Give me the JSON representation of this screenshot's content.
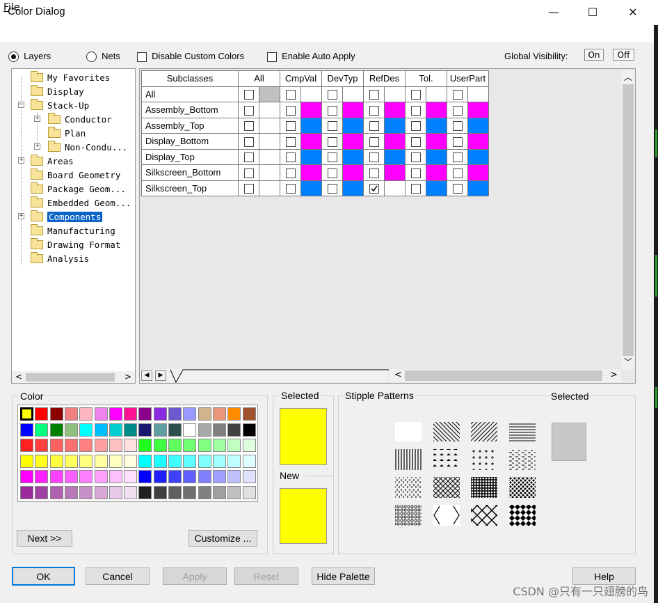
{
  "window": {
    "title": "Color Dialog",
    "minimize": "—",
    "maximize": "☐",
    "close": "✕"
  },
  "menu": {
    "file_u": "F",
    "file_rest": "ile"
  },
  "toolbar": {
    "layers_label": "Layers",
    "nets_label": "Nets",
    "disable_custom_colors": "Disable Custom Colors",
    "enable_auto_apply": "Enable Auto Apply",
    "global_visibility": "Global Visibility:",
    "on": "On",
    "off": "Off"
  },
  "tree": {
    "items": [
      {
        "label": "My Favorites"
      },
      {
        "label": "Display"
      },
      {
        "label": "Stack-Up"
      },
      {
        "label": "Conductor"
      },
      {
        "label": "Plan"
      },
      {
        "label": "Non-Condu..."
      },
      {
        "label": "Areas"
      },
      {
        "label": "Board Geometry"
      },
      {
        "label": "Package Geom..."
      },
      {
        "label": "Embedded Geom..."
      },
      {
        "label": "Components"
      },
      {
        "label": "Manufacturing"
      },
      {
        "label": "Drawing Format"
      },
      {
        "label": "Analysis"
      }
    ]
  },
  "grid": {
    "headers": [
      "Subclasses",
      "All",
      "CmpVal",
      "DevTyp",
      "RefDes",
      "Tol.",
      "UserPart"
    ],
    "rows": [
      {
        "name": "All",
        "colors": [
          "#c0c0c0",
          "#ffffff",
          "#ffffff",
          "#ffffff",
          "#ffffff",
          "#ffffff"
        ],
        "checked": [
          false,
          false,
          false,
          false,
          false,
          false
        ]
      },
      {
        "name": "Assembly_Bottom",
        "colors": [
          "#ffffff",
          "#ff00ff",
          "#ff00ff",
          "#ff00ff",
          "#ff00ff",
          "#ff00ff"
        ],
        "checked": [
          false,
          false,
          false,
          false,
          false,
          false
        ]
      },
      {
        "name": "Assembly_Top",
        "colors": [
          "#ffffff",
          "#0080ff",
          "#0080ff",
          "#0080ff",
          "#0080ff",
          "#0080ff"
        ],
        "checked": [
          false,
          false,
          false,
          false,
          false,
          false
        ]
      },
      {
        "name": "Display_Bottom",
        "colors": [
          "#ffffff",
          "#ff00ff",
          "#ff00ff",
          "#ff00ff",
          "#ff00ff",
          "#ff00ff"
        ],
        "checked": [
          false,
          false,
          false,
          false,
          false,
          false
        ]
      },
      {
        "name": "Display_Top",
        "colors": [
          "#ffffff",
          "#0080ff",
          "#0080ff",
          "#0080ff",
          "#0080ff",
          "#0080ff"
        ],
        "checked": [
          false,
          false,
          false,
          false,
          false,
          false
        ]
      },
      {
        "name": "Silkscreen_Bottom",
        "colors": [
          "#ffffff",
          "#ff00ff",
          "#ff00ff",
          "#ff00ff",
          "#ff00ff",
          "#ff00ff"
        ],
        "checked": [
          false,
          false,
          false,
          false,
          false,
          false
        ]
      },
      {
        "name": "Silkscreen_Top",
        "colors": [
          "#ffffff",
          "#0080ff",
          "#0080ff",
          "#ffffff",
          "#0080ff",
          "#0080ff"
        ],
        "checked": [
          false,
          false,
          false,
          true,
          false,
          false
        ]
      }
    ]
  },
  "color_panel": {
    "title": "Color",
    "selected_label": "Selected",
    "new_label": "New",
    "selected_color": "#ffff00",
    "new_color": "#ffff00",
    "next_button": "Next >>",
    "customize_button": "Customize ...",
    "palette": [
      [
        "#ffff00",
        "#ff0000",
        "#8b0000",
        "#f08080",
        "#ffb6c1",
        "#ee82ee",
        "#ff00ff",
        "#ff1493",
        "#8b008b",
        "#8a2be2",
        "#6a5acd",
        "#9999ff",
        "#d2b48c",
        "#e9967a",
        "#ff8c00",
        "#a0522d"
      ],
      [
        "#0000ff",
        "#00ff7f",
        "#008000",
        "#90c080",
        "#00ffff",
        "#00bfff",
        "#00ced1",
        "#008b8b",
        "#191970",
        "#5f9ea0",
        "#2f4f4f",
        "#ffffff",
        "#a9a9a9",
        "#808080",
        "#404040",
        "#000000"
      ],
      [
        "#ff2020",
        "#ff4040",
        "#ff6060",
        "#ff7070",
        "#ff8080",
        "#ffa0a0",
        "#ffc0c0",
        "#ffe0e0",
        "#20ff20",
        "#40ff40",
        "#60ff60",
        "#70ff70",
        "#80ff80",
        "#a0ffa0",
        "#c0ffc0",
        "#e0ffe0"
      ],
      [
        "#ffff00",
        "#ffff20",
        "#ffff40",
        "#ffff60",
        "#ffff80",
        "#ffffa0",
        "#ffffc0",
        "#ffffe0",
        "#00ffff",
        "#20ffff",
        "#40ffff",
        "#60ffff",
        "#80ffff",
        "#a0ffff",
        "#c0ffff",
        "#e0ffff"
      ],
      [
        "#ff00ff",
        "#ff20ff",
        "#ff40ff",
        "#ff60ff",
        "#ff80ff",
        "#ffa0ff",
        "#ffc0ff",
        "#ffe0ff",
        "#0000ff",
        "#2020ff",
        "#4040ff",
        "#6060ff",
        "#8080ff",
        "#a0a0ff",
        "#c0c0ff",
        "#e0e0ff"
      ],
      [
        "#9a2a9a",
        "#a040a0",
        "#b060b0",
        "#b878b8",
        "#c890c8",
        "#d8a8d8",
        "#e8c8e8",
        "#f0e0f0",
        "#202020",
        "#404040",
        "#606060",
        "#707070",
        "#808080",
        "#a0a0a0",
        "#c0c0c0",
        "#e0e0e0"
      ]
    ]
  },
  "stipple_panel": {
    "title": "Stipple Patterns",
    "selected_label": "Selected",
    "selected_color": "#c8c8c8"
  },
  "buttons": {
    "ok": "OK",
    "cancel": "Cancel",
    "apply": "Apply",
    "reset": "Reset",
    "hide_palette": "Hide Palette",
    "help": "Help"
  },
  "watermark": "CSDN @只有一只翅膀的鸟"
}
